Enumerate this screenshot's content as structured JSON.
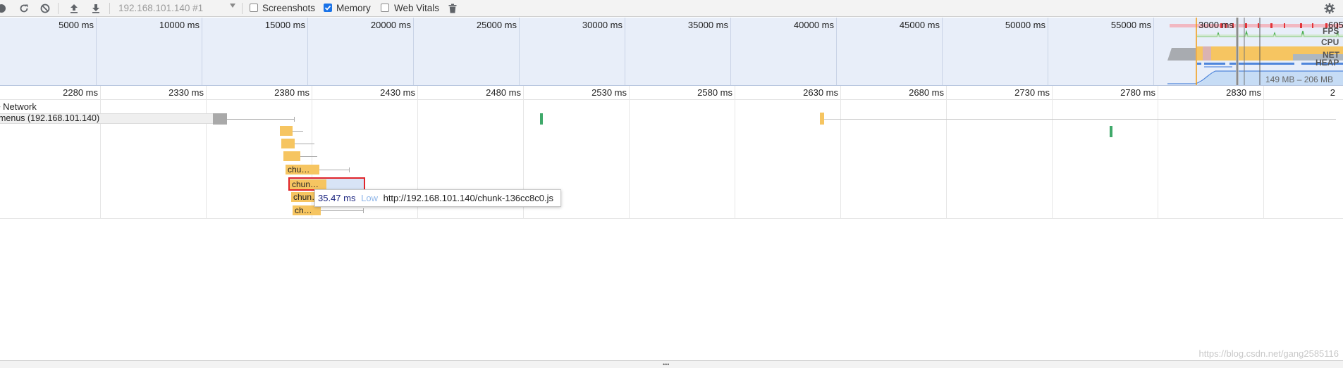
{
  "toolbar": {
    "target": "192.168.101.140 #1",
    "screenshots_label": "Screenshots",
    "screenshots_checked": false,
    "memory_label": "Memory",
    "memory_checked": true,
    "web_vitals_label": "Web Vitals",
    "web_vitals_checked": false
  },
  "overview": {
    "ticks": [
      "5000 ms",
      "10000 ms",
      "15000 ms",
      "20000 ms",
      "25000 ms",
      "30000 ms",
      "35000 ms",
      "40000 ms",
      "45000 ms",
      "50000 ms",
      "55000 ms"
    ],
    "tick_partial_a": "3000 ms",
    "tick_partial_b": "605",
    "labels": {
      "fps": "FPS",
      "cpu": "CPU",
      "net": "NET",
      "heap": "HEAP"
    },
    "heap_range": "149 MB – 206 MB"
  },
  "ruler": {
    "ticks": [
      "2280 ms",
      "2330 ms",
      "2380 ms",
      "2430 ms",
      "2480 ms",
      "2530 ms",
      "2580 ms",
      "2630 ms",
      "2680 ms",
      "2730 ms",
      "2780 ms",
      "2830 ms",
      "2"
    ]
  },
  "network": {
    "title": "Network",
    "title_prefix": "▾",
    "host_row": "menus (192.168.101.140)",
    "bars": [
      "",
      "",
      "",
      "chu…",
      "chun…",
      "chun…",
      "ch…"
    ]
  },
  "tooltip": {
    "duration": "35.47 ms",
    "priority": "Low",
    "url": "http://192.168.101.140/chunk-136cc8c0.js"
  },
  "watermark": "https://blog.csdn.net/gang2585116",
  "colors": {
    "accent": "#1a73e8",
    "bar": "#f6c561",
    "selected_border": "#e0242b",
    "fps": "#e1353a",
    "cpu": "#f6c561",
    "net": "#4f86db"
  }
}
